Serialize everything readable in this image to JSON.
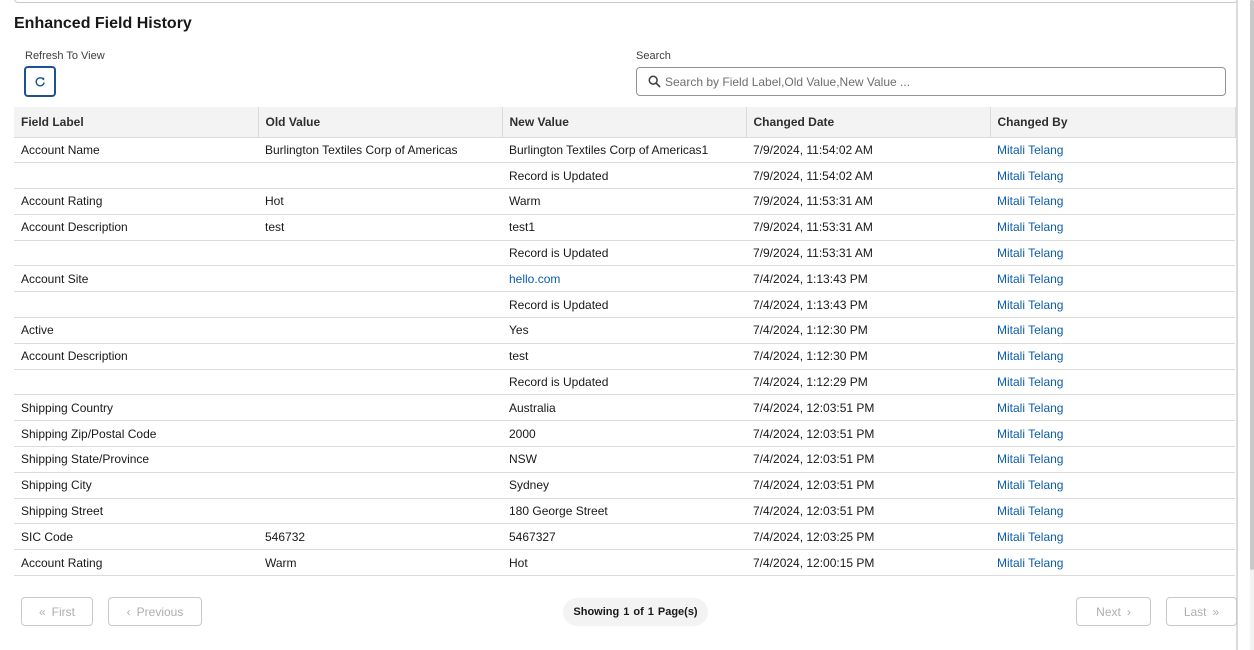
{
  "page": {
    "title": "Enhanced Field History"
  },
  "refresh": {
    "label": "Refresh To View"
  },
  "search": {
    "label": "Search",
    "placeholder": "Search by Field Label,Old Value,New Value ...",
    "value": ""
  },
  "table": {
    "columns": [
      "Field Label",
      "Old Value",
      "New Value",
      "Changed Date",
      "Changed By"
    ],
    "rows": [
      [
        "Account Name",
        "Burlington Textiles Corp of Americas",
        "Burlington Textiles Corp of Americas1",
        "7/9/2024, 11:54:02 AM",
        "Mitali Telang"
      ],
      [
        "",
        "",
        "Record is Updated",
        "7/9/2024, 11:54:02 AM",
        "Mitali Telang"
      ],
      [
        "Account Rating",
        "Hot",
        "Warm",
        "7/9/2024, 11:53:31 AM",
        "Mitali Telang"
      ],
      [
        "Account Description",
        "test",
        "test1",
        "7/9/2024, 11:53:31 AM",
        "Mitali Telang"
      ],
      [
        "",
        "",
        "Record is Updated",
        "7/9/2024, 11:53:31 AM",
        "Mitali Telang"
      ],
      [
        "Account Site",
        "",
        "hello.com",
        "7/4/2024, 1:13:43 PM",
        "Mitali Telang"
      ],
      [
        "",
        "",
        "Record is Updated",
        "7/4/2024, 1:13:43 PM",
        "Mitali Telang"
      ],
      [
        "Active",
        "",
        "Yes",
        "7/4/2024, 1:12:30 PM",
        "Mitali Telang"
      ],
      [
        "Account Description",
        "",
        "test",
        "7/4/2024, 1:12:30 PM",
        "Mitali Telang"
      ],
      [
        "",
        "",
        "Record is Updated",
        "7/4/2024, 1:12:29 PM",
        "Mitali Telang"
      ],
      [
        "Shipping Country",
        "",
        "Australia",
        "7/4/2024, 12:03:51 PM",
        "Mitali Telang"
      ],
      [
        "Shipping Zip/Postal Code",
        "",
        "2000",
        "7/4/2024, 12:03:51 PM",
        "Mitali Telang"
      ],
      [
        "Shipping State/Province",
        "",
        "NSW",
        "7/4/2024, 12:03:51 PM",
        "Mitali Telang"
      ],
      [
        "Shipping City",
        "",
        "Sydney",
        "7/4/2024, 12:03:51 PM",
        "Mitali Telang"
      ],
      [
        "Shipping Street",
        "",
        "180 George Street",
        "7/4/2024, 12:03:51 PM",
        "Mitali Telang"
      ],
      [
        "SIC Code",
        "546732",
        "5467327",
        "7/4/2024, 12:03:25 PM",
        "Mitali Telang"
      ],
      [
        "Account Rating",
        "Warm",
        "Hot",
        "7/4/2024, 12:00:15 PM",
        "Mitali Telang"
      ]
    ],
    "link_color": "#0b5cab"
  },
  "pagination": {
    "first_label": "First",
    "previous_label": "Previous",
    "next_label": "Next",
    "last_label": "Last",
    "showing_label": "Showing",
    "current_page": "1",
    "of_label": "of",
    "total_pages": "1",
    "pages_label": "Page(s)"
  },
  "colors": {
    "accent": "#1b5297",
    "header_bg": "#f3f3f3",
    "border": "#dddbda",
    "link": "#0b5cab"
  }
}
